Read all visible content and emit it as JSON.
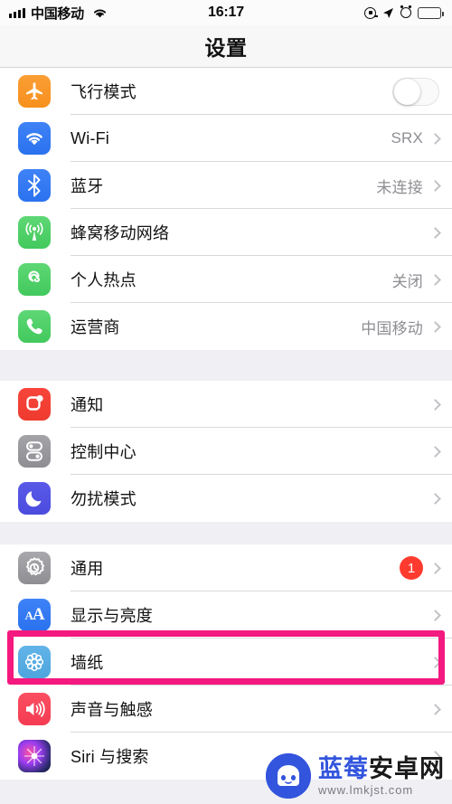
{
  "status_bar": {
    "carrier": "中国移动",
    "time": "16:17",
    "icons": [
      "signal-bars",
      "wifi-icon",
      "orientation-lock-icon",
      "location-arrow-icon",
      "alarm-icon",
      "battery-icon"
    ]
  },
  "nav": {
    "title": "设置"
  },
  "groups": [
    {
      "rows": [
        {
          "icon": "airplane-icon",
          "label": "飞行模式",
          "control": "toggle",
          "toggle_on": false
        },
        {
          "icon": "wifi-icon",
          "label": "Wi-Fi",
          "value": "SRX",
          "control": "chevron"
        },
        {
          "icon": "bluetooth-icon",
          "label": "蓝牙",
          "value": "未连接",
          "control": "chevron"
        },
        {
          "icon": "cellular-icon",
          "label": "蜂窝移动网络",
          "value": "",
          "control": "chevron"
        },
        {
          "icon": "hotspot-icon",
          "label": "个人热点",
          "value": "关闭",
          "control": "chevron"
        },
        {
          "icon": "phone-icon",
          "label": "运营商",
          "value": "中国移动",
          "control": "chevron"
        }
      ]
    },
    {
      "rows": [
        {
          "icon": "notifications-icon",
          "label": "通知",
          "value": "",
          "control": "chevron"
        },
        {
          "icon": "control-center-icon",
          "label": "控制中心",
          "value": "",
          "control": "chevron"
        },
        {
          "icon": "do-not-disturb-icon",
          "label": "勿扰模式",
          "value": "",
          "control": "chevron"
        }
      ]
    },
    {
      "rows": [
        {
          "icon": "general-gear-icon",
          "label": "通用",
          "badge": "1",
          "control": "chevron"
        },
        {
          "icon": "display-brightness-icon",
          "label": "显示与亮度",
          "value": "",
          "control": "chevron",
          "highlighted": true
        },
        {
          "icon": "wallpaper-icon",
          "label": "墙纸",
          "value": "",
          "control": "chevron"
        },
        {
          "icon": "sounds-haptics-icon",
          "label": "声音与触感",
          "value": "",
          "control": "chevron"
        },
        {
          "icon": "siri-icon",
          "label": "Siri 与搜索",
          "value": "",
          "control": "chevron"
        }
      ]
    }
  ],
  "highlight": {
    "color": "#f4197f",
    "target_label": "显示与亮度"
  },
  "watermark": {
    "name_blue": "蓝莓",
    "name_black": "安卓网",
    "url": "www.lmkjst.com"
  }
}
